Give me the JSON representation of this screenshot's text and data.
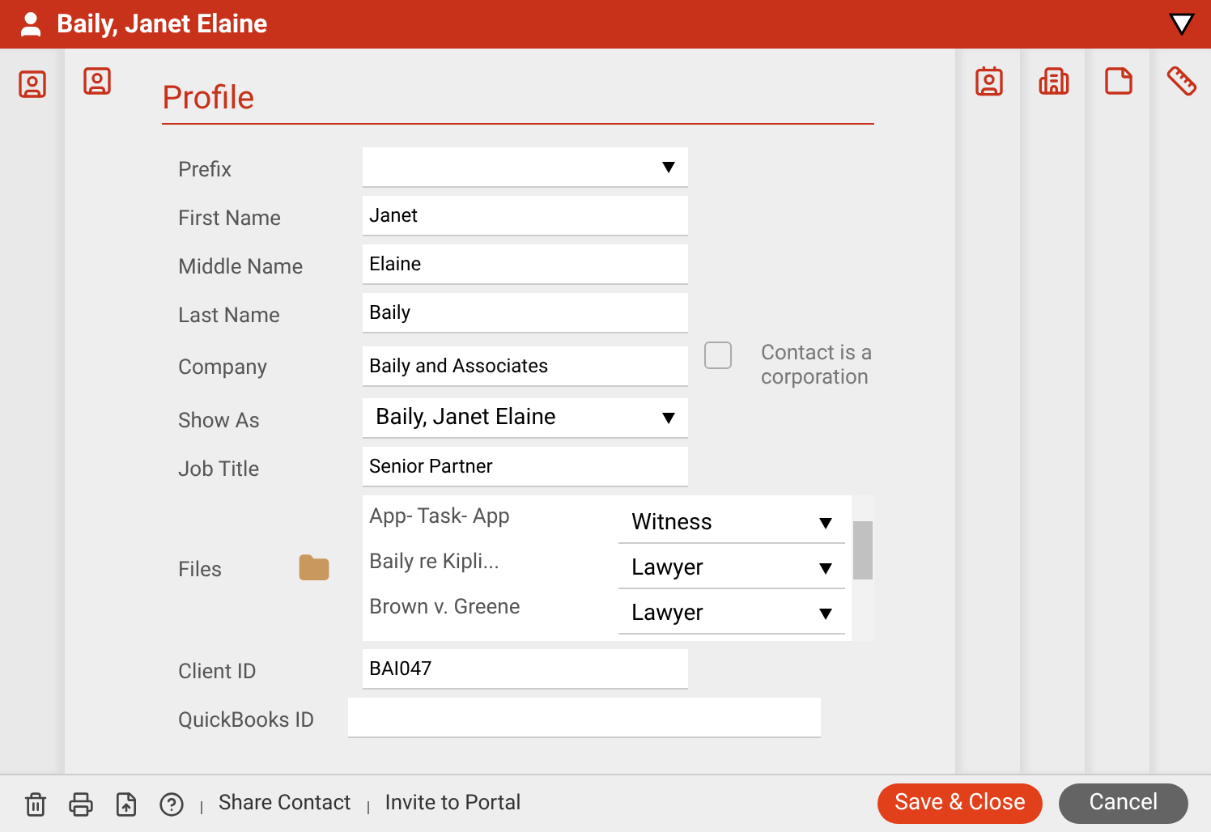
{
  "window": {
    "title": "Baily, Janet Elaine"
  },
  "left_tabs": [
    {
      "selected": true
    }
  ],
  "right_tabs": [
    {
      "kind": "card"
    },
    {
      "kind": "building"
    },
    {
      "kind": "note"
    },
    {
      "kind": "ruler"
    }
  ],
  "section": {
    "title": "Profile"
  },
  "fields": [
    {
      "kind": "select",
      "label": "Prefix"
    },
    {
      "kind": "text",
      "label": "First Name",
      "value": "Janet"
    },
    {
      "kind": "text",
      "label": "Middle Name",
      "value": "Elaine"
    },
    {
      "kind": "text",
      "label": "Last Name",
      "value": "Baily"
    },
    {
      "kind": "text",
      "label": "Company",
      "value": "Baily and Associates",
      "checkbox": {
        "label": "Contact is a corporation",
        "checked": false
      }
    },
    {
      "kind": "select",
      "label": "Show As",
      "value": "Baily, Janet Elaine"
    },
    {
      "kind": "text",
      "label": "Job Title",
      "value": "Senior Partner"
    },
    {
      "kind": "files",
      "label": "Files",
      "files": [
        {
          "name": "App- Task- App",
          "role": "Witness"
        },
        {
          "name": "Baily re Kipli...",
          "role": "Lawyer"
        },
        {
          "name": "Brown v. Greene",
          "role": "Lawyer"
        }
      ]
    },
    {
      "kind": "text",
      "label": "Client ID",
      "value": "BAI047"
    },
    {
      "kind": "wide",
      "label": "QuickBooks ID"
    }
  ],
  "footer": {
    "links": [
      "Share Contact",
      "Invite to Portal"
    ],
    "buttons": [
      {
        "label": "Save & Close",
        "kind": "primary"
      },
      {
        "label": "Cancel",
        "kind": "secondary"
      }
    ]
  }
}
